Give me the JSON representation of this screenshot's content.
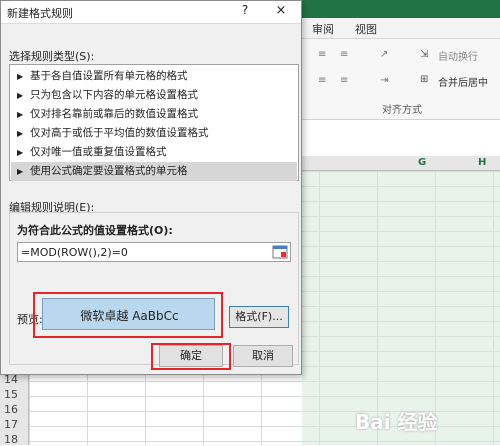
{
  "excel": {
    "ribbon_tabs": [
      "审阅",
      "视图"
    ],
    "ribbon_items": [
      "自动换行",
      "合并后居中",
      "对齐方式"
    ],
    "columns": [
      "G",
      "H"
    ],
    "rows": [
      "14",
      "15",
      "16",
      "17",
      "18"
    ],
    "watermark": "Bai 经验"
  },
  "dialog": {
    "title": "新建格式规则",
    "help": "?",
    "close": "×",
    "rule_type_label": "选择规则类型(S):",
    "rule_types": [
      "基于各自值设置所有单元格的格式",
      "只为包含以下内容的单元格设置格式",
      "仅对排名靠前或靠后的数值设置格式",
      "仅对高于或低于平均值的数值设置格式",
      "仅对唯一值或重复值设置格式",
      "使用公式确定要设置格式的单元格"
    ],
    "selected_index": 5,
    "description_label": "编辑规则说明(E):",
    "formula_label": "为符合此公式的值设置格式(O):",
    "formula_value": "=MOD(ROW(),2)=0",
    "preview_label": "预览:",
    "preview_text": "微软卓越  AaBbCc",
    "format_button": "格式(F)...",
    "ok_button": "确定",
    "cancel_button": "取消"
  },
  "colors": {
    "accent": "#217346",
    "highlight_red": "#e4262a",
    "preview_fill": "#b9d8ee",
    "row_band": "#d6ead9"
  }
}
